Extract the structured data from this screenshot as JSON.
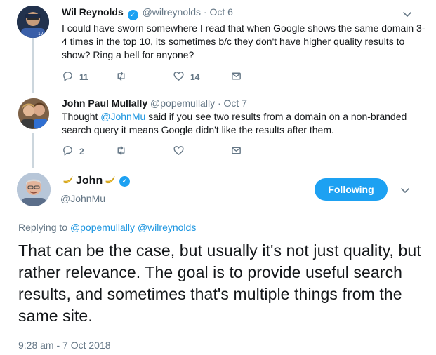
{
  "tweets": [
    {
      "name": "Wil Reynolds",
      "handle_meta": "@wilreynolds · Oct 6",
      "text": "I could have sworn somewhere I read that when Google shows the same domain 3-4 times in the top 10, its sometimes b/c they don't have higher quality results to show? Ring a bell for anyone?",
      "replies": "11",
      "retweets": "",
      "likes": "14"
    },
    {
      "name": "John Paul Mullally",
      "handle_meta": "@popemullally · Oct 7",
      "text_before": "Thought ",
      "mention": "@JohnMu",
      "text_after": " said if you see two results  from a domain on a non-branded search query it means Google didn't like the results after them.",
      "replies": "2",
      "retweets": "",
      "likes": ""
    }
  ],
  "main": {
    "name": "John",
    "handle": "@JohnMu",
    "follow_label": "Following",
    "replying_label": "Replying to ",
    "reply_mentions": "@popemullally @wilreynolds",
    "text": "That can be the case, but usually it's not just quality, but rather relevance. The goal is to provide useful search results, and sometimes that's multiple things from the same site.",
    "timestamp": "9:28 am - 7 Oct 2018"
  },
  "colors": {
    "accent": "#1da1f2",
    "link": "#1b95e0",
    "muted": "#657786",
    "thread_line": "#ccd6dd"
  },
  "icons": [
    "chevron-down-icon",
    "reply-icon",
    "retweet-icon",
    "like-icon",
    "message-icon",
    "verified-icon",
    "banana-icon"
  ]
}
